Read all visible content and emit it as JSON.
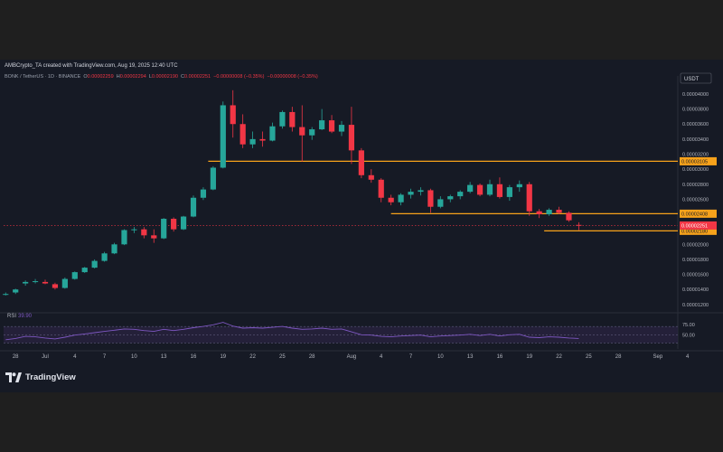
{
  "header": {
    "text": "AMBCrypto_TA created with TradingView.com, Aug 19, 2025 12:40 UTC"
  },
  "legend": {
    "symbol": "BONK / TetherUS · 1D · BINANCE",
    "o_label": "O",
    "o": "0.00002259",
    "h_label": "H",
    "h": "0.00002294",
    "l_label": "L",
    "l": "0.00002190",
    "c_label": "C",
    "c": "0.00002251",
    "change": "−0.00000008 (−0.35%)",
    "change2": "−0.00000008 (−0.35%)"
  },
  "currency": "USDT",
  "brand": "TradingView",
  "colors": {
    "up": "#26a69a",
    "down": "#f23645",
    "level": "#f7a21b",
    "rsi_line": "#7e57c2",
    "rsi_band": "#2a2340"
  },
  "chart_data": {
    "type": "candlestick",
    "y_ticks": [
      "0.00004000",
      "0.00003800",
      "0.00003600",
      "0.00003400",
      "0.00003200",
      "0.00003000",
      "0.00002800",
      "0.00002600",
      "0.00002400",
      "0.00002200",
      "0.00002000",
      "0.00001800",
      "0.00001600",
      "0.00001400",
      "0.00001200"
    ],
    "ylim": [
      1.15e-05,
      4.12e-05
    ],
    "x_ticks": [
      {
        "label": "28",
        "day": -3
      },
      {
        "label": "Jul",
        "day": 0
      },
      {
        "label": "4",
        "day": 3
      },
      {
        "label": "7",
        "day": 6
      },
      {
        "label": "10",
        "day": 9
      },
      {
        "label": "13",
        "day": 12
      },
      {
        "label": "16",
        "day": 15
      },
      {
        "label": "19",
        "day": 18
      },
      {
        "label": "22",
        "day": 21
      },
      {
        "label": "25",
        "day": 24
      },
      {
        "label": "28",
        "day": 27
      },
      {
        "label": "Aug",
        "day": 31
      },
      {
        "label": "4",
        "day": 34
      },
      {
        "label": "7",
        "day": 37
      },
      {
        "label": "10",
        "day": 40
      },
      {
        "label": "13",
        "day": 43
      },
      {
        "label": "16",
        "day": 46
      },
      {
        "label": "19",
        "day": 49
      },
      {
        "label": "22",
        "day": 52
      },
      {
        "label": "25",
        "day": 55
      },
      {
        "label": "28",
        "day": 58
      },
      {
        "label": "Sep",
        "day": 62
      },
      {
        "label": "4",
        "day": 65
      }
    ],
    "candles": [
      [
        1.33e-05,
        1.36e-05,
        1.32e-05,
        1.34e-05
      ],
      [
        1.36e-05,
        1.41e-05,
        1.34e-05,
        1.4e-05
      ],
      [
        1.48e-05,
        1.52e-05,
        1.45e-05,
        1.5e-05
      ],
      [
        1.5e-05,
        1.54e-05,
        1.48e-05,
        1.51e-05
      ],
      [
        1.5e-05,
        1.53e-05,
        1.47e-05,
        1.48e-05
      ],
      [
        1.47e-05,
        1.49e-05,
        1.4e-05,
        1.42e-05
      ],
      [
        1.42e-05,
        1.56e-05,
        1.41e-05,
        1.54e-05
      ],
      [
        1.54e-05,
        1.64e-05,
        1.53e-05,
        1.63e-05
      ],
      [
        1.63e-05,
        1.7e-05,
        1.62e-05,
        1.69e-05
      ],
      [
        1.69e-05,
        1.8e-05,
        1.68e-05,
        1.78e-05
      ],
      [
        1.78e-05,
        1.9e-05,
        1.77e-05,
        1.88e-05
      ],
      [
        1.88e-05,
        2.02e-05,
        1.87e-05,
        2e-05
      ],
      [
        2e-05,
        2.2e-05,
        1.99e-05,
        2.19e-05
      ],
      [
        2.19e-05,
        2.23e-05,
        2.15e-05,
        2.2e-05
      ],
      [
        2.2e-05,
        2.23e-05,
        2.08e-05,
        2.12e-05
      ],
      [
        2.12e-05,
        2.2e-05,
        2.02e-05,
        2.08e-05
      ],
      [
        2.08e-05,
        2.35e-05,
        2.07e-05,
        2.34e-05
      ],
      [
        2.34e-05,
        2.36e-05,
        2.17e-05,
        2.2e-05
      ],
      [
        2.2e-05,
        2.38e-05,
        2.19e-05,
        2.37e-05
      ],
      [
        2.37e-05,
        2.65e-05,
        2.36e-05,
        2.62e-05
      ],
      [
        2.62e-05,
        2.76e-05,
        2.59e-05,
        2.73e-05
      ],
      [
        2.73e-05,
        3.04e-05,
        2.72e-05,
        3.02e-05
      ],
      [
        3.02e-05,
        3.9e-05,
        3.01e-05,
        3.85e-05
      ],
      [
        3.85e-05,
        4.05e-05,
        3.42e-05,
        3.6e-05
      ],
      [
        3.6e-05,
        3.73e-05,
        3.28e-05,
        3.33e-05
      ],
      [
        3.33e-05,
        3.5e-05,
        3.28e-05,
        3.4e-05
      ],
      [
        3.4e-05,
        3.5e-05,
        3.3e-05,
        3.38e-05
      ],
      [
        3.38e-05,
        3.62e-05,
        3.37e-05,
        3.57e-05
      ],
      [
        3.57e-05,
        3.78e-05,
        3.54e-05,
        3.76e-05
      ],
      [
        3.76e-05,
        3.83e-05,
        3.5e-05,
        3.56e-05
      ],
      [
        3.56e-05,
        3.85e-05,
        3.1e-05,
        3.45e-05
      ],
      [
        3.45e-05,
        3.56e-05,
        3.39e-05,
        3.53e-05
      ],
      [
        3.53e-05,
        3.8e-05,
        3.52e-05,
        3.65e-05
      ],
      [
        3.65e-05,
        3.72e-05,
        3.48e-05,
        3.5e-05
      ],
      [
        3.5e-05,
        3.64e-05,
        3.44e-05,
        3.59e-05
      ],
      [
        3.59e-05,
        3.83e-05,
        3.07e-05,
        3.25e-05
      ],
      [
        3.25e-05,
        3.28e-05,
        2.88e-05,
        2.92e-05
      ],
      [
        2.92e-05,
        3e-05,
        2.82e-05,
        2.86e-05
      ],
      [
        2.86e-05,
        2.88e-05,
        2.56e-05,
        2.62e-05
      ],
      [
        2.62e-05,
        2.66e-05,
        2.52e-05,
        2.56e-05
      ],
      [
        2.56e-05,
        2.68e-05,
        2.52e-05,
        2.66e-05
      ],
      [
        2.66e-05,
        2.74e-05,
        2.61e-05,
        2.7e-05
      ],
      [
        2.7e-05,
        2.76e-05,
        2.65e-05,
        2.72e-05
      ],
      [
        2.72e-05,
        2.74e-05,
        2.42e-05,
        2.5e-05
      ],
      [
        2.5e-05,
        2.64e-05,
        2.48e-05,
        2.6e-05
      ],
      [
        2.6e-05,
        2.66e-05,
        2.56e-05,
        2.64e-05
      ],
      [
        2.64e-05,
        2.72e-05,
        2.6e-05,
        2.7e-05
      ],
      [
        2.7e-05,
        2.83e-05,
        2.68e-05,
        2.79e-05
      ],
      [
        2.79e-05,
        2.81e-05,
        2.64e-05,
        2.66e-05
      ],
      [
        2.66e-05,
        2.86e-05,
        2.64e-05,
        2.8e-05
      ],
      [
        2.8e-05,
        2.89e-05,
        2.61e-05,
        2.63e-05
      ],
      [
        2.63e-05,
        2.79e-05,
        2.58e-05,
        2.76e-05
      ],
      [
        2.76e-05,
        2.85e-05,
        2.7e-05,
        2.8e-05
      ],
      [
        2.8e-05,
        2.83e-05,
        2.38e-05,
        2.44e-05
      ],
      [
        2.44e-05,
        2.47e-05,
        2.35e-05,
        2.4e-05
      ],
      [
        2.4e-05,
        2.48e-05,
        2.38e-05,
        2.46e-05
      ],
      [
        2.46e-05,
        2.5e-05,
        2.4e-05,
        2.42e-05
      ],
      [
        2.42e-05,
        2.44e-05,
        2.3e-05,
        2.32e-05
      ],
      [
        2.259e-05,
        2.294e-05,
        2.19e-05,
        2.251e-05
      ]
    ],
    "levels": [
      {
        "price": 3.105e-05,
        "label": "0.00003105",
        "from": 16.5
      },
      {
        "price": 2.408e-05,
        "label": "0.00002408",
        "from": 35
      },
      {
        "price": 2.18e-05,
        "label": "0.00002180",
        "from": 50.5
      }
    ],
    "last_price": {
      "price": 2.251e-05,
      "label": "0.00002251"
    },
    "rsi": {
      "label": "RSI",
      "value": "39.90",
      "upper": 70,
      "lower": 30,
      "middle": 50,
      "tick_labels": [
        "75.00",
        "50.00"
      ],
      "values": [
        38,
        41,
        46,
        45,
        42,
        40,
        44,
        49,
        52,
        55,
        58,
        61,
        64,
        63,
        60,
        58,
        63,
        60,
        63,
        67,
        70,
        74,
        80,
        71,
        66,
        67,
        66,
        68,
        70,
        66,
        63,
        64,
        66,
        63,
        64,
        57,
        50,
        49,
        46,
        45,
        47,
        48,
        49,
        45,
        47,
        48,
        49,
        51,
        48,
        51,
        47,
        50,
        51,
        44,
        43,
        45,
        44,
        42,
        41
      ]
    }
  }
}
